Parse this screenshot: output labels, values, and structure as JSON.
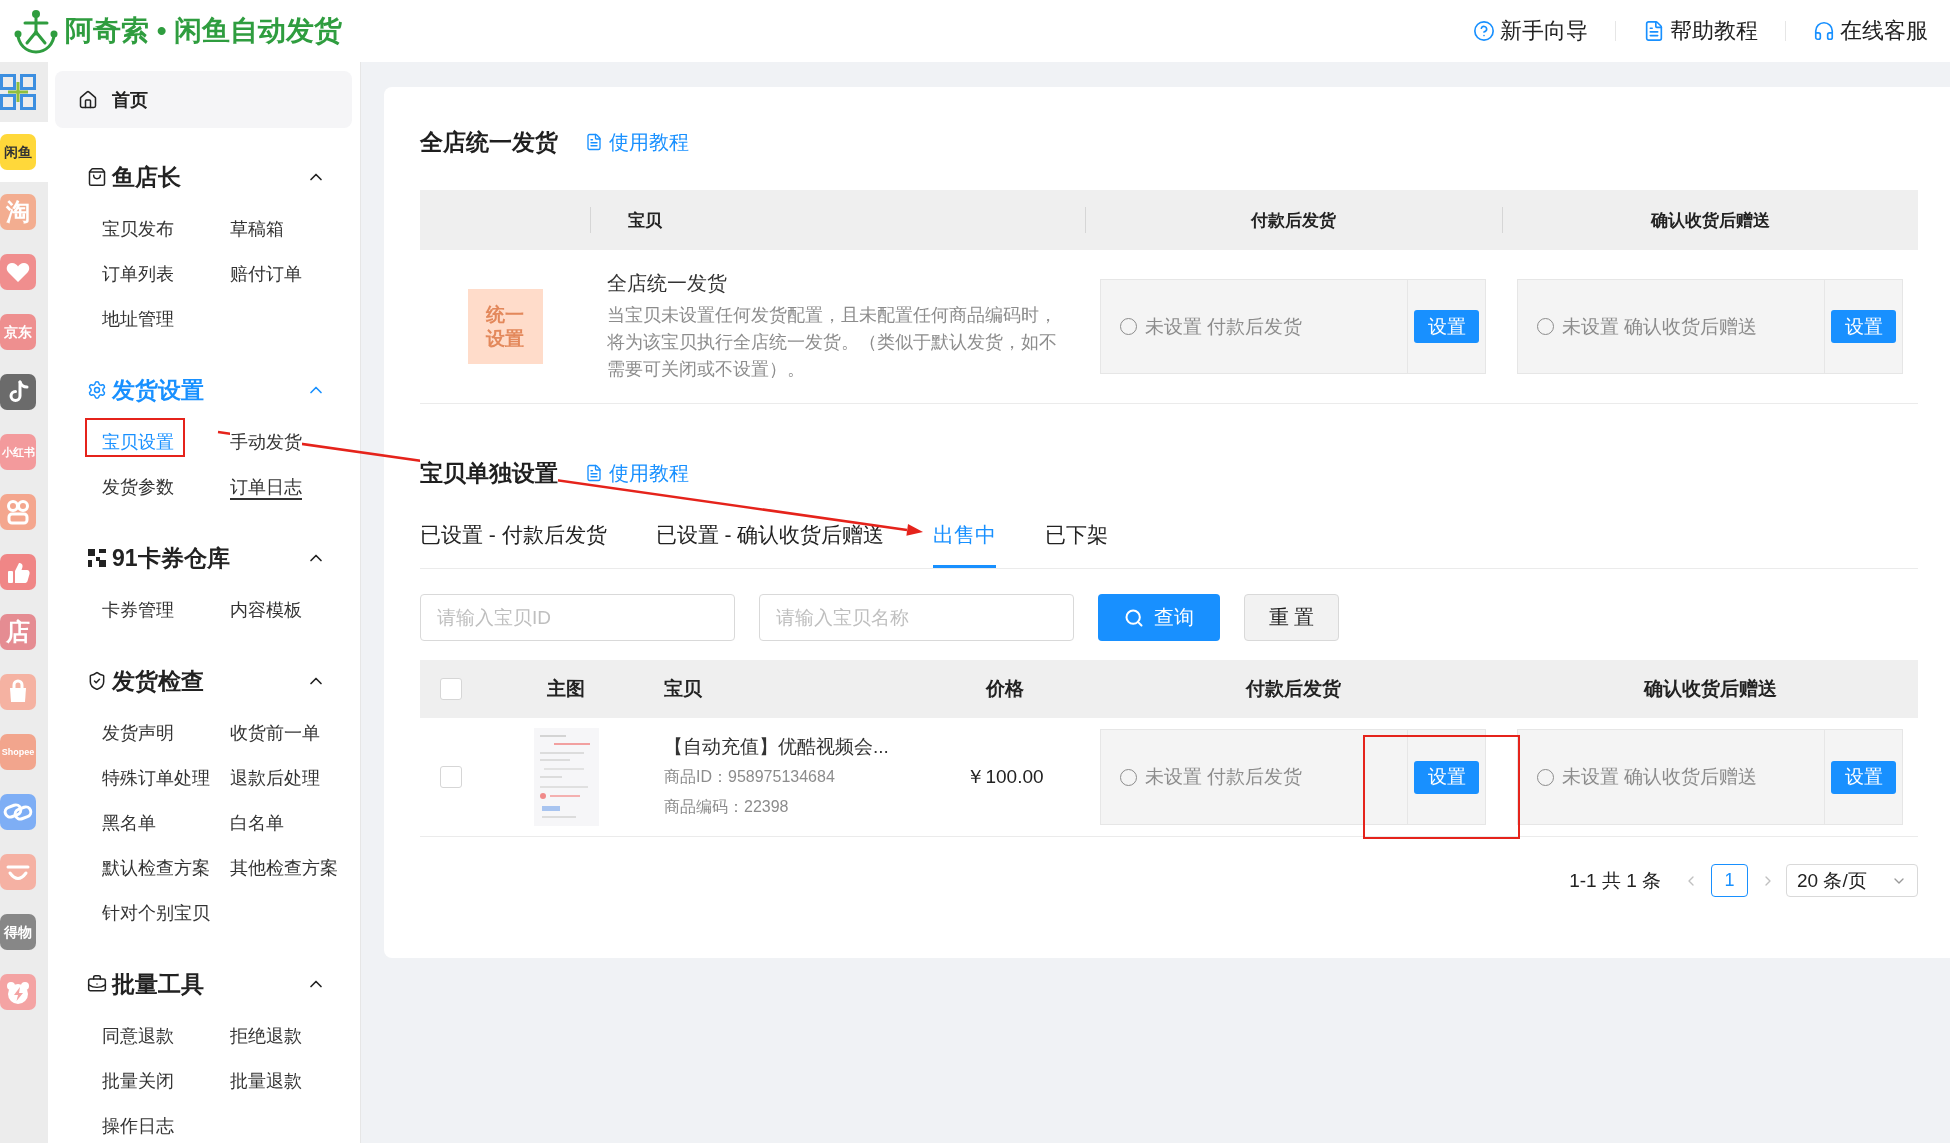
{
  "header": {
    "title": "阿奇索 • 闲鱼自动发货",
    "links": [
      {
        "kind": "help",
        "label": "新手向导"
      },
      {
        "kind": "doc",
        "label": "帮助教程"
      },
      {
        "kind": "headset",
        "label": "在线客服"
      }
    ]
  },
  "platform_bar": [
    {
      "kind": "grid",
      "color": "#3d8fe0",
      "selected": false
    },
    {
      "kind": "text",
      "label": "闲鱼",
      "color": "#ffd83a",
      "selected": true
    },
    {
      "kind": "text",
      "label": "淘",
      "color": "#f3ad90",
      "selected": false
    },
    {
      "kind": "heart",
      "color": "#f08e8e",
      "selected": false
    },
    {
      "kind": "text",
      "label": "京东",
      "color": "#ee8f8f",
      "selected": false
    },
    {
      "kind": "note",
      "color": "#6b6b6b",
      "selected": false
    },
    {
      "kind": "text",
      "label": "小红书",
      "color": "#f39a9c",
      "selected": false
    },
    {
      "kind": "rings",
      "color": "#f4a68e",
      "selected": false
    },
    {
      "kind": "thumb",
      "color": "#f08686",
      "selected": false
    },
    {
      "kind": "text",
      "label": "店",
      "color": "#e58c92",
      "selected": false
    },
    {
      "kind": "bag",
      "color": "#f5b2a2",
      "selected": false
    },
    {
      "kind": "text",
      "label": "Shopee",
      "color": "#f2a58d",
      "selected": false
    },
    {
      "kind": "link",
      "color": "#7eaef5",
      "selected": false
    },
    {
      "kind": "smile",
      "color": "#f5b1a3",
      "selected": false
    },
    {
      "kind": "text",
      "label": "得物",
      "color": "#878787",
      "selected": false
    },
    {
      "kind": "bear",
      "color": "#f4a3a3",
      "selected": false
    }
  ],
  "sidebar": {
    "home": {
      "label": "首页"
    },
    "groups": [
      {
        "kind": "bag",
        "title": "鱼店长",
        "selected": false,
        "expanded": true,
        "items": [
          {
            "label": "宝贝发布",
            "selected": false,
            "hovered": false,
            "annotated": false
          },
          {
            "label": "草稿箱",
            "selected": false,
            "hovered": false,
            "annotated": false
          },
          {
            "label": "订单列表",
            "selected": false,
            "hovered": false,
            "annotated": false
          },
          {
            "label": "赔付订单",
            "selected": false,
            "hovered": false,
            "annotated": false
          },
          {
            "label": "地址管理",
            "selected": false,
            "hovered": false,
            "annotated": false
          }
        ]
      },
      {
        "kind": "gear",
        "title": "发货设置",
        "selected": true,
        "expanded": true,
        "items": [
          {
            "label": "宝贝设置",
            "selected": true,
            "hovered": false,
            "annotated": true
          },
          {
            "label": "手动发货",
            "selected": false,
            "hovered": false,
            "annotated": false
          },
          {
            "label": "发货参数",
            "selected": false,
            "hovered": false,
            "annotated": false
          },
          {
            "label": "订单日志",
            "selected": false,
            "hovered": true,
            "annotated": false
          }
        ]
      },
      {
        "kind": "squares",
        "title": "91卡券仓库",
        "selected": false,
        "expanded": true,
        "items": [
          {
            "label": "卡券管理",
            "selected": false,
            "hovered": false,
            "annotated": false
          },
          {
            "label": "内容模板",
            "selected": false,
            "hovered": false,
            "annotated": false
          }
        ]
      },
      {
        "kind": "shield",
        "title": "发货检查",
        "selected": false,
        "expanded": true,
        "items": [
          {
            "label": "发货声明",
            "selected": false,
            "hovered": false,
            "annotated": false
          },
          {
            "label": "收货前一单",
            "selected": false,
            "hovered": false,
            "annotated": false
          },
          {
            "label": "特殊订单处理",
            "selected": false,
            "hovered": false,
            "annotated": false
          },
          {
            "label": "退款后处理",
            "selected": false,
            "hovered": false,
            "annotated": false
          },
          {
            "label": "黑名单",
            "selected": false,
            "hovered": false,
            "annotated": false
          },
          {
            "label": "白名单",
            "selected": false,
            "hovered": false,
            "annotated": false
          },
          {
            "label": "默认检查方案",
            "selected": false,
            "hovered": false,
            "annotated": false
          },
          {
            "label": "其他检查方案",
            "selected": false,
            "hovered": false,
            "annotated": false
          },
          {
            "label": "针对个别宝贝",
            "selected": false,
            "hovered": false,
            "annotated": false
          }
        ]
      },
      {
        "kind": "briefcase",
        "title": "批量工具",
        "selected": false,
        "expanded": true,
        "items": [
          {
            "label": "同意退款",
            "selected": false,
            "hovered": false,
            "annotated": false
          },
          {
            "label": "拒绝退款",
            "selected": false,
            "hovered": false,
            "annotated": false
          },
          {
            "label": "批量关闭",
            "selected": false,
            "hovered": false,
            "annotated": false
          },
          {
            "label": "批量退款",
            "selected": false,
            "hovered": false,
            "annotated": false
          },
          {
            "label": "操作日志",
            "selected": false,
            "hovered": false,
            "annotated": false
          }
        ]
      }
    ]
  },
  "unified_section": {
    "title": "全店统一发货",
    "tutorial_link": "使用教程",
    "columns": [
      "宝贝",
      "付款后发货",
      "确认收货后赠送"
    ],
    "row": {
      "badge": "统一设置",
      "title": "全店统一发货",
      "description": "当宝贝未设置任何发货配置，且未配置任何商品编码时，将为该宝贝执行全店统一发货。（类似于默认发货，如不需要可关闭或不设置）。",
      "settings": [
        {
          "checked": false,
          "status": "未设置 付款后发货",
          "button": "设置",
          "annotated": false
        },
        {
          "checked": false,
          "status": "未设置 确认收货后赠送",
          "button": "设置",
          "annotated": false
        }
      ]
    }
  },
  "item_section": {
    "title": "宝贝单独设置",
    "tutorial_link": "使用教程",
    "tabs": [
      {
        "label": "已设置 - 付款后发货",
        "selected": false
      },
      {
        "label": "已设置 - 确认收货后赠送",
        "selected": false
      },
      {
        "label": "出售中",
        "selected": true
      },
      {
        "label": "已下架",
        "selected": false
      }
    ],
    "filters": {
      "id_field": {
        "placeholder": "请输入宝贝ID"
      },
      "name_field": {
        "placeholder": "请输入宝贝名称"
      },
      "search_button": "查询",
      "reset_button": "重 置"
    },
    "columns": [
      "主图",
      "宝贝",
      "价格",
      "付款后发货",
      "确认收货后赠送"
    ],
    "select_all_checked": false,
    "rows": [
      {
        "checked": false,
        "title": "【自动充值】优酷视频会...",
        "product_id": "商品ID：958975134684",
        "product_code": "商品编码：22398",
        "price": "￥100.00",
        "settings": [
          {
            "checked": false,
            "status": "未设置 付款后发货",
            "button": "设置",
            "annotated": true
          },
          {
            "checked": false,
            "status": "未设置 确认收货后赠送",
            "button": "设置",
            "annotated": false
          }
        ]
      }
    ],
    "pagination": {
      "summary": "1-1 共 1 条",
      "pages": [
        {
          "label": "1",
          "selected": true
        }
      ],
      "page_size": "20 条/页"
    }
  },
  "annotation_arrow": true
}
